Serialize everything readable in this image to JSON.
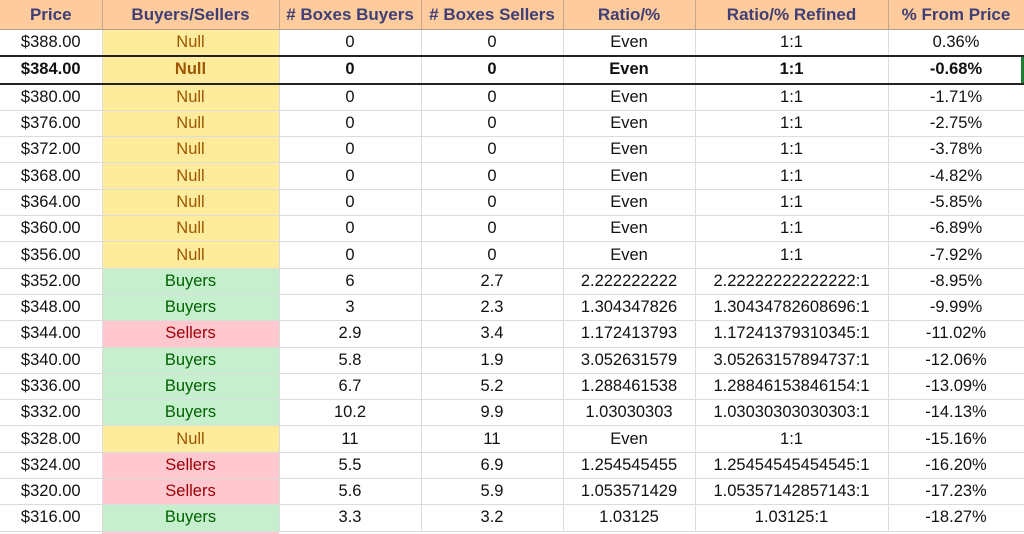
{
  "sheet": {
    "columns": [
      "Price",
      "Buyers/Sellers",
      "# Boxes Buyers",
      "# Boxes Sellers",
      "Ratio/%",
      "Ratio/% Refined",
      "% From Price"
    ],
    "highlighted_row_index": 1,
    "signal_colors": {
      "Null": {
        "bg": "#ffeb9c",
        "fg": "#9c5700"
      },
      "Buyers": {
        "bg": "#c6efce",
        "fg": "#006100"
      },
      "Sellers": {
        "bg": "#ffc7ce",
        "fg": "#9c0006"
      }
    },
    "header_color": "#fdcb9c",
    "rows": [
      [
        "$388.00",
        "Null",
        "0",
        "0",
        "Even",
        "1:1",
        "0.36%"
      ],
      [
        "$384.00",
        "Null",
        "0",
        "0",
        "Even",
        "1:1",
        "-0.68%"
      ],
      [
        "$380.00",
        "Null",
        "0",
        "0",
        "Even",
        "1:1",
        "-1.71%"
      ],
      [
        "$376.00",
        "Null",
        "0",
        "0",
        "Even",
        "1:1",
        "-2.75%"
      ],
      [
        "$372.00",
        "Null",
        "0",
        "0",
        "Even",
        "1:1",
        "-3.78%"
      ],
      [
        "$368.00",
        "Null",
        "0",
        "0",
        "Even",
        "1:1",
        "-4.82%"
      ],
      [
        "$364.00",
        "Null",
        "0",
        "0",
        "Even",
        "1:1",
        "-5.85%"
      ],
      [
        "$360.00",
        "Null",
        "0",
        "0",
        "Even",
        "1:1",
        "-6.89%"
      ],
      [
        "$356.00",
        "Null",
        "0",
        "0",
        "Even",
        "1:1",
        "-7.92%"
      ],
      [
        "$352.00",
        "Buyers",
        "6",
        "2.7",
        "2.222222222",
        "2.22222222222222:1",
        "-8.95%"
      ],
      [
        "$348.00",
        "Buyers",
        "3",
        "2.3",
        "1.304347826",
        "1.30434782608696:1",
        "-9.99%"
      ],
      [
        "$344.00",
        "Sellers",
        "2.9",
        "3.4",
        "1.172413793",
        "1.17241379310345:1",
        "-11.02%"
      ],
      [
        "$340.00",
        "Buyers",
        "5.8",
        "1.9",
        "3.052631579",
        "3.05263157894737:1",
        "-12.06%"
      ],
      [
        "$336.00",
        "Buyers",
        "6.7",
        "5.2",
        "1.288461538",
        "1.28846153846154:1",
        "-13.09%"
      ],
      [
        "$332.00",
        "Buyers",
        "10.2",
        "9.9",
        "1.03030303",
        "1.03030303030303:1",
        "-14.13%"
      ],
      [
        "$328.00",
        "Null",
        "11",
        "11",
        "Even",
        "1:1",
        "-15.16%"
      ],
      [
        "$324.00",
        "Sellers",
        "5.5",
        "6.9",
        "1.254545455",
        "1.25454545454545:1",
        "-16.20%"
      ],
      [
        "$320.00",
        "Sellers",
        "5.6",
        "5.9",
        "1.053571429",
        "1.05357142857143:1",
        "-17.23%"
      ],
      [
        "$316.00",
        "Buyers",
        "3.3",
        "3.2",
        "1.03125",
        "1.03125:1",
        "-18.27%"
      ]
    ]
  }
}
